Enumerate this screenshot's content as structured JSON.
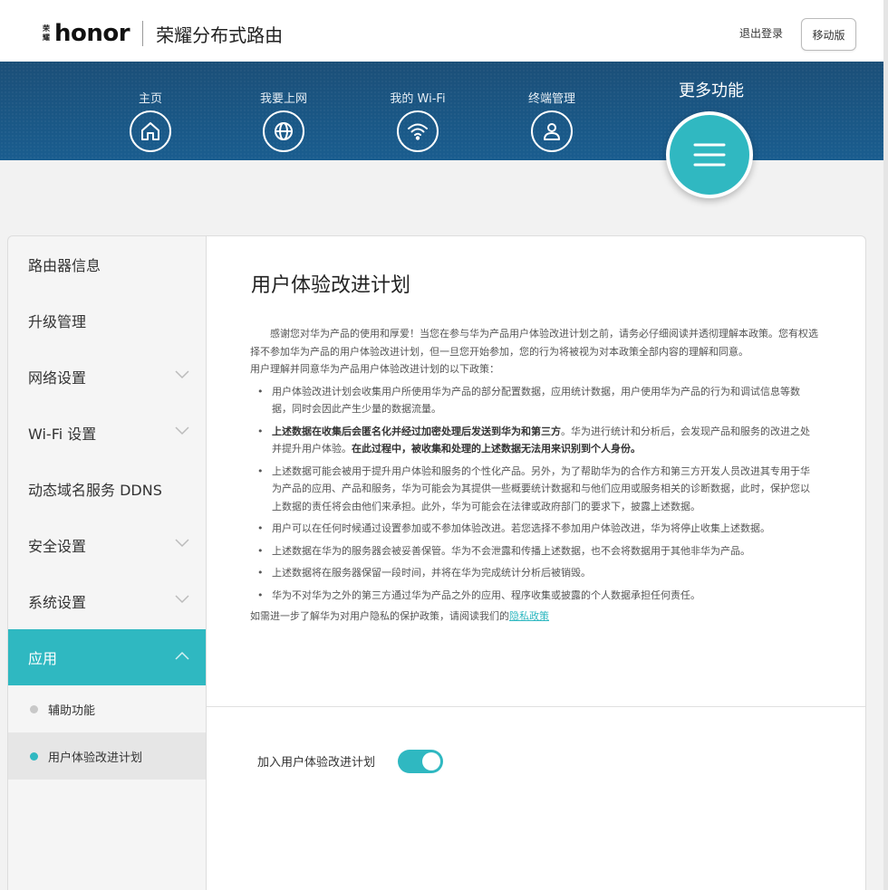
{
  "header": {
    "logo_small_top": "荣",
    "logo_small_bottom": "耀",
    "logo_word": "honor",
    "title": "荣耀分布式路由",
    "logout": "退出登录",
    "mobile_button": "移动版"
  },
  "nav": {
    "items": [
      {
        "label": "主页",
        "icon": "home-icon"
      },
      {
        "label": "我要上网",
        "icon": "globe-icon"
      },
      {
        "label": "我的 Wi-Fi",
        "icon": "wifi-icon"
      },
      {
        "label": "终端管理",
        "icon": "user-icon"
      }
    ],
    "more_label": "更多功能",
    "more_icon": "menu-icon",
    "accent_color": "#30b8c1"
  },
  "sidebar": {
    "items": [
      {
        "label": "路由器信息",
        "has_chevron": false
      },
      {
        "label": "升级管理",
        "has_chevron": false
      },
      {
        "label": "网络设置",
        "has_chevron": true
      },
      {
        "label": "Wi-Fi 设置",
        "has_chevron": true
      },
      {
        "label": "动态域名服务 DDNS",
        "has_chevron": false
      },
      {
        "label": "安全设置",
        "has_chevron": true
      },
      {
        "label": "系统设置",
        "has_chevron": true
      },
      {
        "label": "应用",
        "has_chevron": true,
        "active": true
      }
    ],
    "sub_items": [
      {
        "label": "辅助功能",
        "selected": false
      },
      {
        "label": "用户体验改进计划",
        "selected": true
      }
    ]
  },
  "main": {
    "title": "用户体验改进计划",
    "intro": "感谢您对华为产品的使用和厚爱！当您在参与华为产品用户体验改进计划之前，请务必仔细阅读并透彻理解本政策。您有权选择不参加华为产品的用户体验改进计划，但一旦您开始参加，您的行为将被视为对本政策全部内容的理解和同意。",
    "lead": "用户理解并同意华为产品用户体验改进计划的以下政策：",
    "bullet1": "用户体验改进计划会收集用户所使用华为产品的部分配置数据，应用统计数据，用户使用华为产品的行为和调试信息等数据，同时会因此产生少量的数据流量。",
    "bullet2_bold": "上述数据在收集后会匿名化并经过加密处理后发送到华为和第三方",
    "bullet2_mid": "。华为进行统计和分析后，会发现产品和服务的改进之处并提升用户体验。",
    "bullet2_bold2": "在此过程中，被收集和处理的上述数据无法用来识别到个人身份。",
    "bullet3": "上述数据可能会被用于提升用户体验和服务的个性化产品。另外，为了帮助华为的合作方和第三方开发人员改进其专用于华为产品的应用、产品和服务，华为可能会为其提供一些概要统计数据和与他们应用或服务相关的诊断数据，此时，保护您以上数据的责任将会由他们来承担。此外，华为可能会在法律或政府部门的要求下，披露上述数据。",
    "bullet4": "用户可以在任何时候通过设置参加或不参加体验改进。若您选择不参加用户体验改进，华为将停止收集上述数据。",
    "bullet5": "上述数据在华为的服务器会被妥善保管。华为不会泄露和传播上述数据，也不会将数据用于其他非华为产品。",
    "bullet6": "上述数据将在服务器保留一段时间，并将在华为完成统计分析后被销毁。",
    "bullet7": "华为不对华为之外的第三方通过华为产品之外的应用、程序收集或披露的个人数据承担任何责任。",
    "footer_text": "如需进一步了解华为对用户隐私的保护政策，请阅读我们的",
    "footer_link": "隐私政策",
    "toggle_label": "加入用户体验改进计划",
    "toggle_on": true
  }
}
